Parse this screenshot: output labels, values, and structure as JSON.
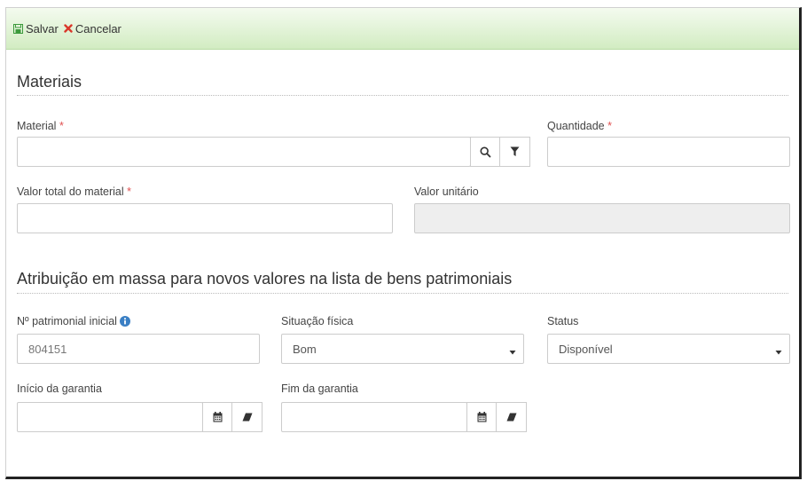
{
  "toolbar": {
    "save_label": "Salvar",
    "cancel_label": "Cancelar"
  },
  "materials": {
    "title": "Materiais",
    "material_label": "Material",
    "required_mark": "*",
    "material_value": "",
    "quantity_label": "Quantidade",
    "quantity_value": "",
    "total_value_label": "Valor total do material",
    "total_value_value": "",
    "unit_value_label": "Valor unitário",
    "unit_value_value": ""
  },
  "mass_assignment": {
    "title": "Atribuição em massa para novos valores na lista de bens patrimoniais",
    "initial_number_label": "Nº patrimonial inicial",
    "initial_number_value": "804151",
    "physical_condition_label": "Situação física",
    "physical_condition_value": "Bom",
    "status_label": "Status",
    "status_value": "Disponível",
    "warranty_start_label": "Início da garantia",
    "warranty_start_value": "",
    "warranty_end_label": "Fim da garantia",
    "warranty_end_value": ""
  },
  "icons": {
    "save": "floppy-icon",
    "cancel": "close-icon",
    "search": "search-icon",
    "filter": "filter-icon",
    "calendar": "calendar-icon",
    "eraser": "eraser-icon",
    "info": "info-icon",
    "dropdown": "caret-down-icon"
  },
  "colors": {
    "toolbar_green": "#d2ecc2",
    "save_icon": "#3c9a3c",
    "cancel_icon": "#d9382a",
    "required": "#e05050",
    "info_icon": "#3a7fc4"
  }
}
